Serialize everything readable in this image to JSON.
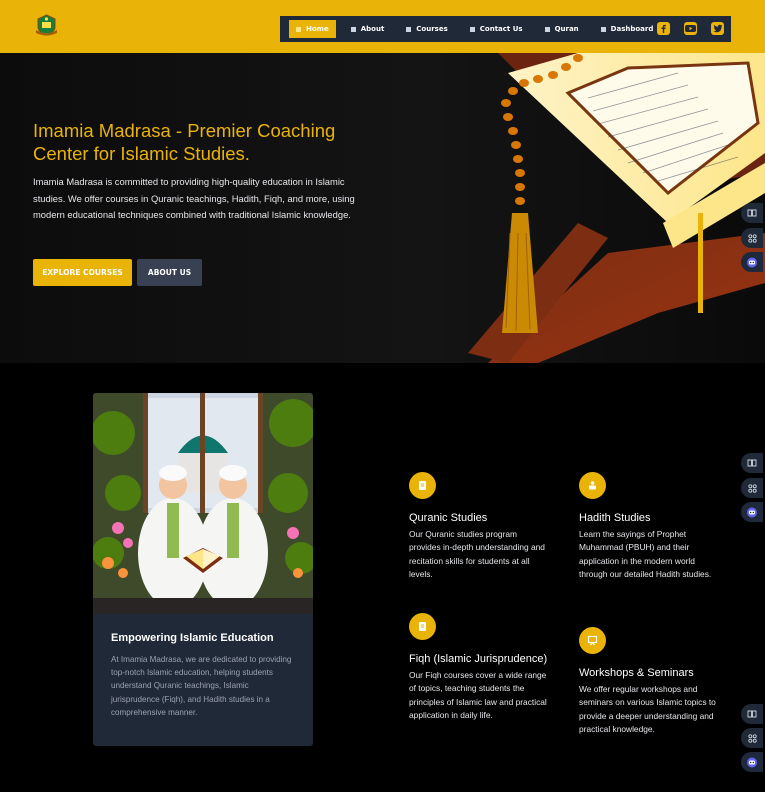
{
  "nav": {
    "items": [
      {
        "label": "Home",
        "active": true
      },
      {
        "label": "About",
        "active": false
      },
      {
        "label": "Courses",
        "active": false
      },
      {
        "label": "Contact Us",
        "active": false
      },
      {
        "label": "Quran",
        "active": false
      },
      {
        "label": "Dashboard",
        "active": false
      }
    ],
    "social": [
      "facebook-icon",
      "youtube-icon",
      "twitter-icon"
    ]
  },
  "hero": {
    "title": "Imamia Madrasa - Premier Coaching Center for Islamic Studies.",
    "description": "Imamia Madrasa is committed to providing high-quality education in Islamic studies. We offer courses in Quranic teachings, Hadith, Fiqh, and more, using modern educational techniques combined with traditional Islamic knowledge.",
    "primary_button": "EXPLORE COURSES",
    "secondary_button": "ABOUT US"
  },
  "card": {
    "title": "Empowering Islamic Education",
    "text": "At Imamia Madrasa, we are dedicated to providing top-notch Islamic education, helping students understand Quranic teachings, Islamic jurisprudence (Fiqh), and Hadith studies in a comprehensive manner."
  },
  "features": [
    {
      "title": "Quranic Studies",
      "text": "Our Quranic studies program provides in-depth understanding and recitation skills for students at all levels."
    },
    {
      "title": "Hadith Studies",
      "text": "Learn the sayings of Prophet Muhammad (PBUH) and their application in the modern world through our detailed Hadith studies."
    },
    {
      "title": "Fiqh (Islamic Jurisprudence)",
      "text": "Our Fiqh courses cover a wide range of topics, teaching students the principles of Islamic law and practical application in daily life."
    },
    {
      "title": "Workshops & Seminars",
      "text": "We offer regular workshops and seminars on various Islamic topics to provide a deeper understanding and practical knowledge."
    }
  ],
  "colors": {
    "accent": "#eab308",
    "nav_bg": "#1f2937",
    "card_bg": "#1f2937"
  }
}
